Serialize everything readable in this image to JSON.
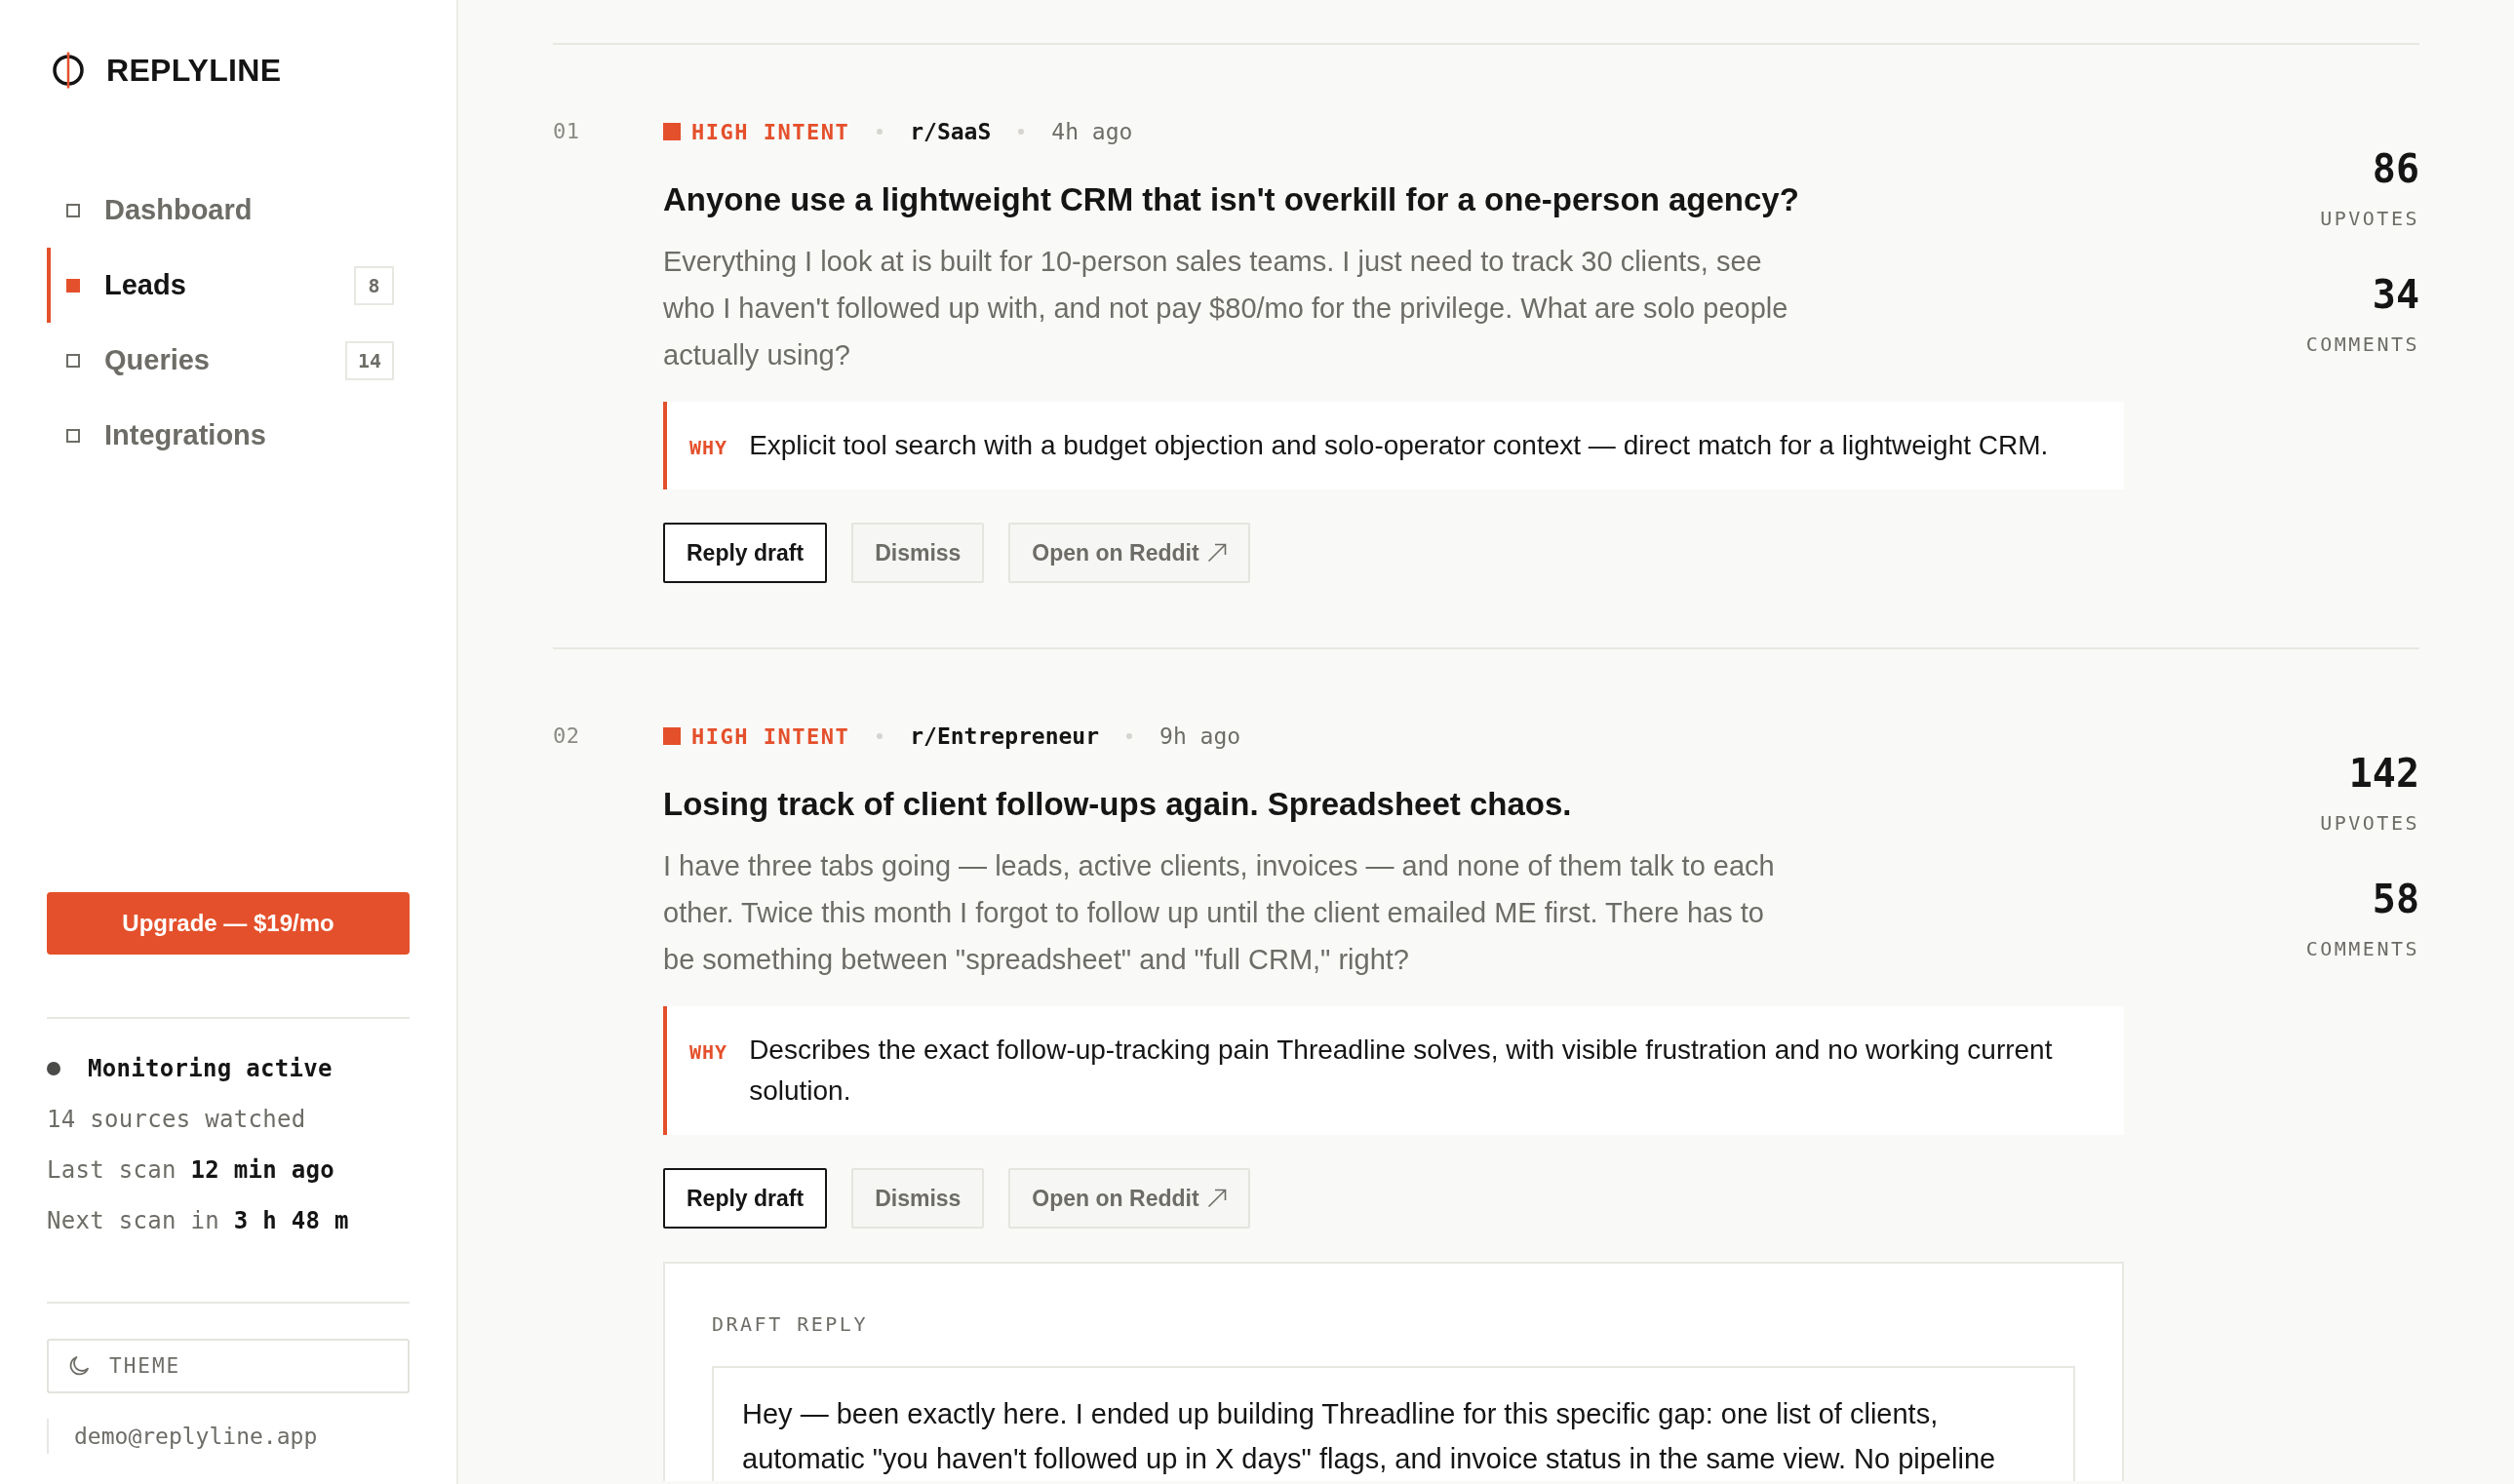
{
  "brand": {
    "name": "REPLYLINE"
  },
  "sidebar": {
    "nav": [
      {
        "label": "Dashboard",
        "selected": false
      },
      {
        "label": "Leads",
        "selected": true,
        "count": "8"
      },
      {
        "label": "Queries",
        "selected": false,
        "count": "14"
      },
      {
        "label": "Integrations",
        "selected": false
      }
    ],
    "upgrade_button": "Upgrade — $19/mo",
    "monitoring": {
      "status": "Monitoring active",
      "sources": "14 sources watched",
      "last_scan": "Last scan **12 min ago**",
      "next_scan": "Next scan in **3 h 48 m**"
    },
    "theme_button": "THEME",
    "account_email": "demo@replyline.app"
  },
  "leads": [
    {
      "number": "01",
      "intent": "HIGH INTENT",
      "subreddit": "r/SaaS",
      "age": "4h ago",
      "title": "Anyone use a lightweight CRM that isn't overkill for a one-person agency?",
      "body": "Everything I look at is built for 10-person sales teams. I just need to track 30 clients, see who I haven't followed up with, and not pay $80/mo for the privilege. What are solo people actually using?",
      "why": {
        "label": "WHY",
        "text": "Explicit tool search with a budget objection and solo-operator context — direct match for a lightweight CRM."
      },
      "actions": [
        {
          "label": "Reply draft",
          "kind": "primary"
        },
        {
          "label": "Dismiss",
          "kind": "secondary"
        },
        {
          "label": "Open on Reddit",
          "kind": "external"
        }
      ],
      "stats": [
        {
          "value": "86",
          "label": "UPVOTES"
        },
        {
          "value": "34",
          "label": "COMMENTS"
        }
      ]
    },
    {
      "number": "02",
      "intent": "HIGH INTENT",
      "subreddit": "r/Entrepreneur",
      "age": "9h ago",
      "title": "Losing track of client follow-ups again. Spreadsheet chaos.",
      "body": "I have three tabs going — leads, active clients, invoices — and none of them talk to each other. Twice this month I forgot to follow up until the client emailed ME first. There has to be something between \"spreadsheet\" and \"full CRM,\" right?",
      "why": {
        "label": "WHY",
        "text": "Describes the exact follow-up-tracking pain Threadline solves, with visible frustration and no working current solution."
      },
      "actions": [
        {
          "label": "Reply draft",
          "kind": "primary"
        },
        {
          "label": "Dismiss",
          "kind": "secondary"
        },
        {
          "label": "Open on Reddit",
          "kind": "external"
        }
      ],
      "stats": [
        {
          "value": "142",
          "label": "UPVOTES"
        },
        {
          "value": "58",
          "label": "COMMENTS"
        }
      ],
      "draft": {
        "label": "DRAFT REPLY",
        "value": "Hey — been exactly here. I ended up building Threadline for this specific gap: one list of clients, automatic \"you haven't followed up in X days\" flags, and invoice status in the same view. No pipeline"
      }
    }
  ]
}
